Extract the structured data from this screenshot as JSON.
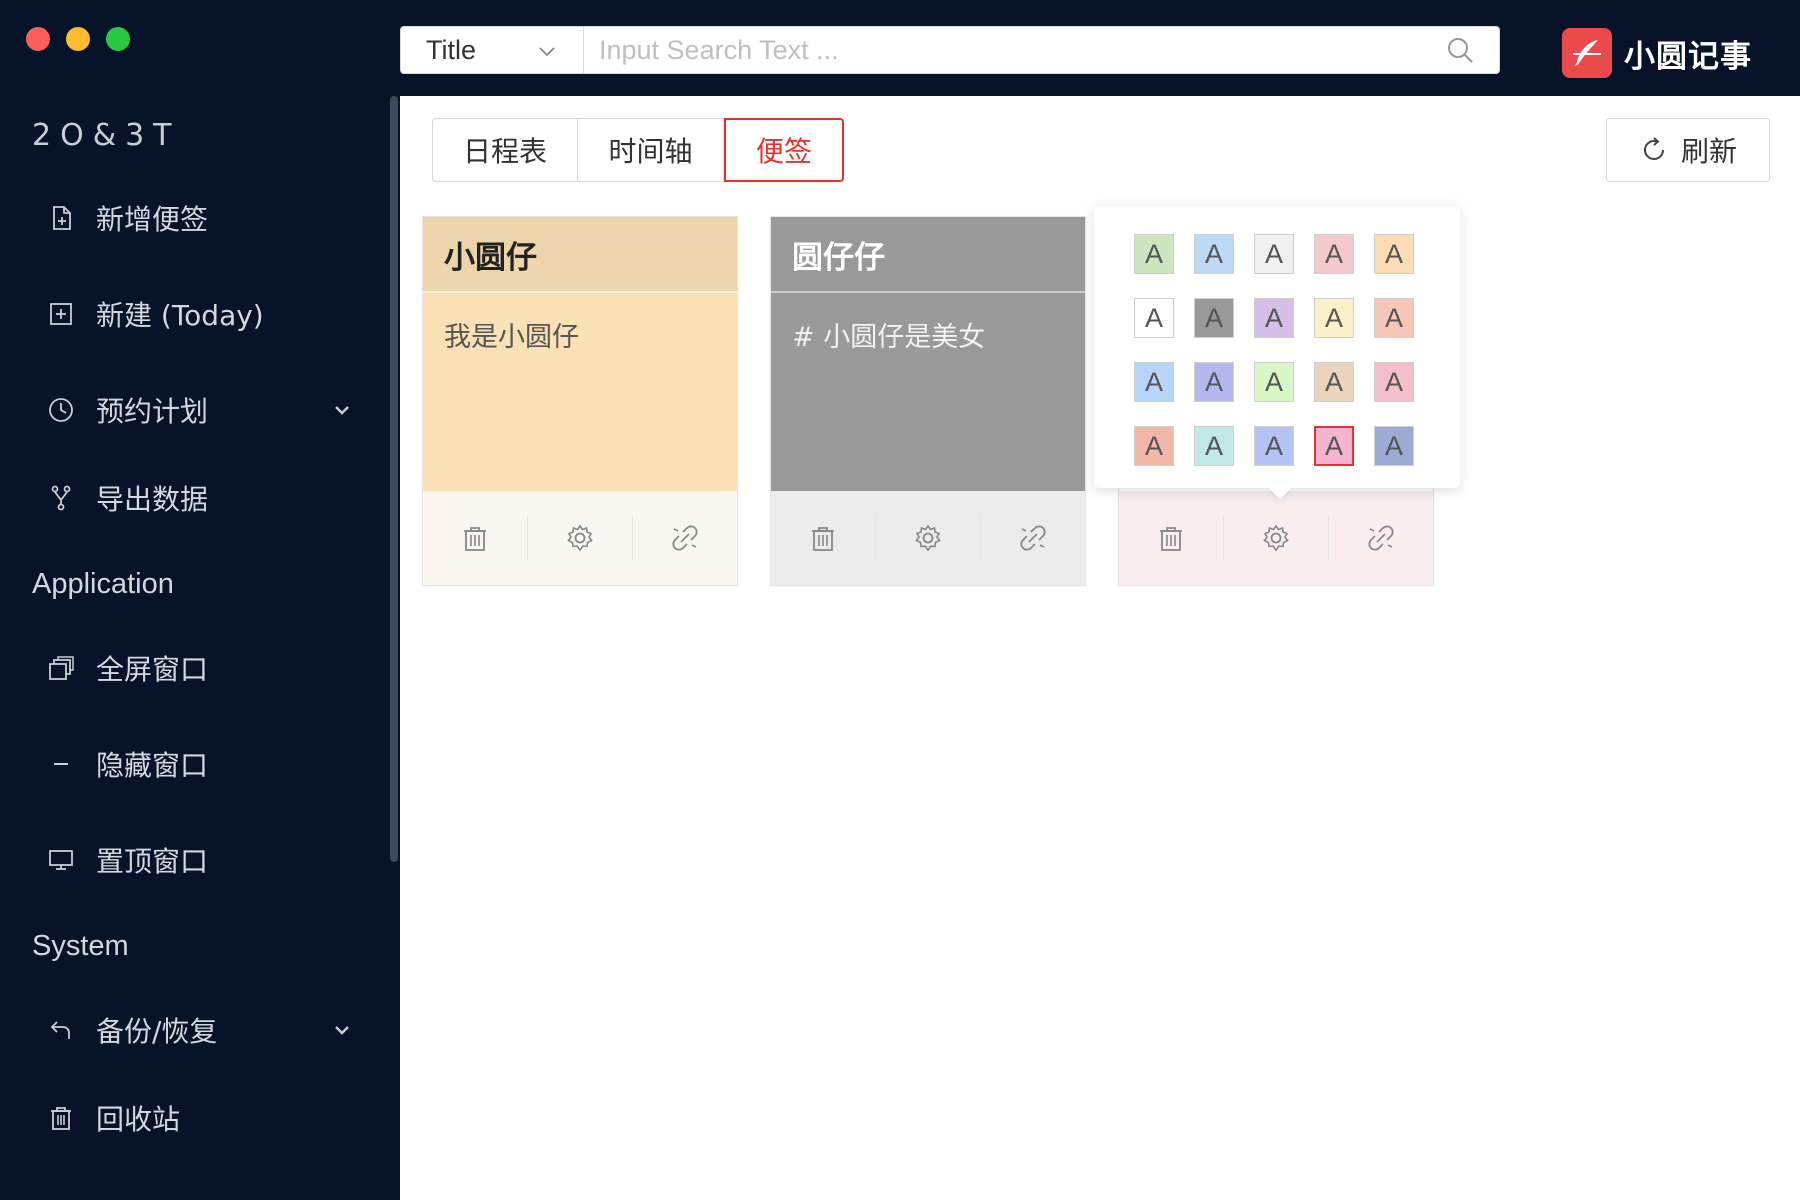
{
  "window": {
    "traffic_lights": [
      "close",
      "minimize",
      "zoom"
    ]
  },
  "search": {
    "field_select": "Title",
    "placeholder": "Input Search Text ...",
    "value": ""
  },
  "brand": {
    "name": "小圆记事",
    "logo_icon": "feather-icon",
    "logo_color": "#ec4a4a"
  },
  "sidebar": {
    "logo_text": "2O&3T",
    "items_main": [
      {
        "label": "新增便签",
        "icon": "file-add-icon"
      },
      {
        "label": "新建 (Today)",
        "icon": "plus-square-icon"
      },
      {
        "label": "预约计划",
        "icon": "clock-icon",
        "expandable": true
      },
      {
        "label": "导出数据",
        "icon": "fork-icon"
      }
    ],
    "group_application": "Application",
    "items_application": [
      {
        "label": "全屏窗口",
        "icon": "windows-icon"
      },
      {
        "label": "隐藏窗口",
        "icon": "minus-icon"
      },
      {
        "label": "置顶窗口",
        "icon": "desktop-icon"
      }
    ],
    "group_system": "System",
    "items_system": [
      {
        "label": "备份/恢复",
        "icon": "rollback-icon",
        "expandable": true
      },
      {
        "label": "回收站",
        "icon": "trash-icon"
      }
    ]
  },
  "tabs": [
    {
      "label": "日程表",
      "active": false
    },
    {
      "label": "时间轴",
      "active": false
    },
    {
      "label": "便签",
      "active": true
    }
  ],
  "refresh_label": "刷新",
  "notes": [
    {
      "title": "小圆仔",
      "body": "我是小圆仔",
      "head_color": "#ecd4ab",
      "body_color": "#f9e0b5",
      "foot_color": "#f9f6ef",
      "text_color": "#222",
      "body_text_color": "#555"
    },
    {
      "title": "圆仔仔",
      "body": "# 小圆仔是美女",
      "head_color": "#999999",
      "body_color": "#999999",
      "foot_color": "#ebebeb",
      "text_color": "#fff",
      "body_text_color": "#f2f2f2"
    },
    {
      "title": "",
      "body": "",
      "head_color": "#ffffff",
      "body_color": "#ffffff",
      "foot_color": "#f8eef0",
      "text_color": "#222",
      "body_text_color": "#555"
    }
  ],
  "note_actions": [
    "delete",
    "settings",
    "unlink"
  ],
  "palette": {
    "label": "A",
    "selected_index": 18,
    "colors": [
      "#cde5bf",
      "#bcd9f6",
      "#f0f0f0",
      "#f5c9cc",
      "#fbdcb5",
      "#ffffff",
      "#999999",
      "#d5bfe8",
      "#fbf1c9",
      "#f4c7b7",
      "#b7d5f8",
      "#b5b6ee",
      "#d9f7c6",
      "#ecd3bd",
      "#f2bfcb",
      "#f1b8a7",
      "#bfe8e6",
      "#b4c3f4",
      "#f2b4d1",
      "#9caad4"
    ]
  }
}
